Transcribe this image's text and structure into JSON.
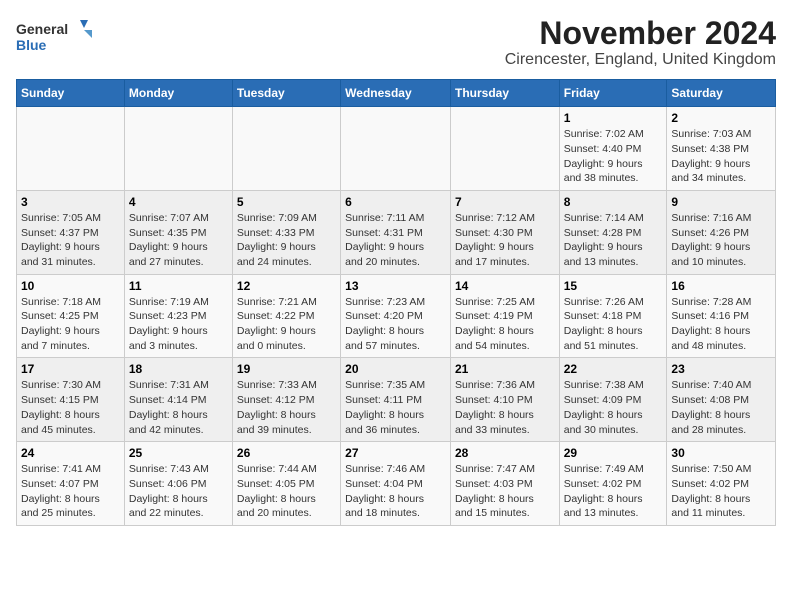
{
  "logo": {
    "general": "General",
    "blue": "Blue"
  },
  "title": "November 2024",
  "subtitle": "Cirencester, England, United Kingdom",
  "weekdays": [
    "Sunday",
    "Monday",
    "Tuesday",
    "Wednesday",
    "Thursday",
    "Friday",
    "Saturday"
  ],
  "weeks": [
    [
      {
        "day": "",
        "info": ""
      },
      {
        "day": "",
        "info": ""
      },
      {
        "day": "",
        "info": ""
      },
      {
        "day": "",
        "info": ""
      },
      {
        "day": "",
        "info": ""
      },
      {
        "day": "1",
        "info": "Sunrise: 7:02 AM\nSunset: 4:40 PM\nDaylight: 9 hours\nand 38 minutes."
      },
      {
        "day": "2",
        "info": "Sunrise: 7:03 AM\nSunset: 4:38 PM\nDaylight: 9 hours\nand 34 minutes."
      }
    ],
    [
      {
        "day": "3",
        "info": "Sunrise: 7:05 AM\nSunset: 4:37 PM\nDaylight: 9 hours\nand 31 minutes."
      },
      {
        "day": "4",
        "info": "Sunrise: 7:07 AM\nSunset: 4:35 PM\nDaylight: 9 hours\nand 27 minutes."
      },
      {
        "day": "5",
        "info": "Sunrise: 7:09 AM\nSunset: 4:33 PM\nDaylight: 9 hours\nand 24 minutes."
      },
      {
        "day": "6",
        "info": "Sunrise: 7:11 AM\nSunset: 4:31 PM\nDaylight: 9 hours\nand 20 minutes."
      },
      {
        "day": "7",
        "info": "Sunrise: 7:12 AM\nSunset: 4:30 PM\nDaylight: 9 hours\nand 17 minutes."
      },
      {
        "day": "8",
        "info": "Sunrise: 7:14 AM\nSunset: 4:28 PM\nDaylight: 9 hours\nand 13 minutes."
      },
      {
        "day": "9",
        "info": "Sunrise: 7:16 AM\nSunset: 4:26 PM\nDaylight: 9 hours\nand 10 minutes."
      }
    ],
    [
      {
        "day": "10",
        "info": "Sunrise: 7:18 AM\nSunset: 4:25 PM\nDaylight: 9 hours\nand 7 minutes."
      },
      {
        "day": "11",
        "info": "Sunrise: 7:19 AM\nSunset: 4:23 PM\nDaylight: 9 hours\nand 3 minutes."
      },
      {
        "day": "12",
        "info": "Sunrise: 7:21 AM\nSunset: 4:22 PM\nDaylight: 9 hours\nand 0 minutes."
      },
      {
        "day": "13",
        "info": "Sunrise: 7:23 AM\nSunset: 4:20 PM\nDaylight: 8 hours\nand 57 minutes."
      },
      {
        "day": "14",
        "info": "Sunrise: 7:25 AM\nSunset: 4:19 PM\nDaylight: 8 hours\nand 54 minutes."
      },
      {
        "day": "15",
        "info": "Sunrise: 7:26 AM\nSunset: 4:18 PM\nDaylight: 8 hours\nand 51 minutes."
      },
      {
        "day": "16",
        "info": "Sunrise: 7:28 AM\nSunset: 4:16 PM\nDaylight: 8 hours\nand 48 minutes."
      }
    ],
    [
      {
        "day": "17",
        "info": "Sunrise: 7:30 AM\nSunset: 4:15 PM\nDaylight: 8 hours\nand 45 minutes."
      },
      {
        "day": "18",
        "info": "Sunrise: 7:31 AM\nSunset: 4:14 PM\nDaylight: 8 hours\nand 42 minutes."
      },
      {
        "day": "19",
        "info": "Sunrise: 7:33 AM\nSunset: 4:12 PM\nDaylight: 8 hours\nand 39 minutes."
      },
      {
        "day": "20",
        "info": "Sunrise: 7:35 AM\nSunset: 4:11 PM\nDaylight: 8 hours\nand 36 minutes."
      },
      {
        "day": "21",
        "info": "Sunrise: 7:36 AM\nSunset: 4:10 PM\nDaylight: 8 hours\nand 33 minutes."
      },
      {
        "day": "22",
        "info": "Sunrise: 7:38 AM\nSunset: 4:09 PM\nDaylight: 8 hours\nand 30 minutes."
      },
      {
        "day": "23",
        "info": "Sunrise: 7:40 AM\nSunset: 4:08 PM\nDaylight: 8 hours\nand 28 minutes."
      }
    ],
    [
      {
        "day": "24",
        "info": "Sunrise: 7:41 AM\nSunset: 4:07 PM\nDaylight: 8 hours\nand 25 minutes."
      },
      {
        "day": "25",
        "info": "Sunrise: 7:43 AM\nSunset: 4:06 PM\nDaylight: 8 hours\nand 22 minutes."
      },
      {
        "day": "26",
        "info": "Sunrise: 7:44 AM\nSunset: 4:05 PM\nDaylight: 8 hours\nand 20 minutes."
      },
      {
        "day": "27",
        "info": "Sunrise: 7:46 AM\nSunset: 4:04 PM\nDaylight: 8 hours\nand 18 minutes."
      },
      {
        "day": "28",
        "info": "Sunrise: 7:47 AM\nSunset: 4:03 PM\nDaylight: 8 hours\nand 15 minutes."
      },
      {
        "day": "29",
        "info": "Sunrise: 7:49 AM\nSunset: 4:02 PM\nDaylight: 8 hours\nand 13 minutes."
      },
      {
        "day": "30",
        "info": "Sunrise: 7:50 AM\nSunset: 4:02 PM\nDaylight: 8 hours\nand 11 minutes."
      }
    ]
  ]
}
